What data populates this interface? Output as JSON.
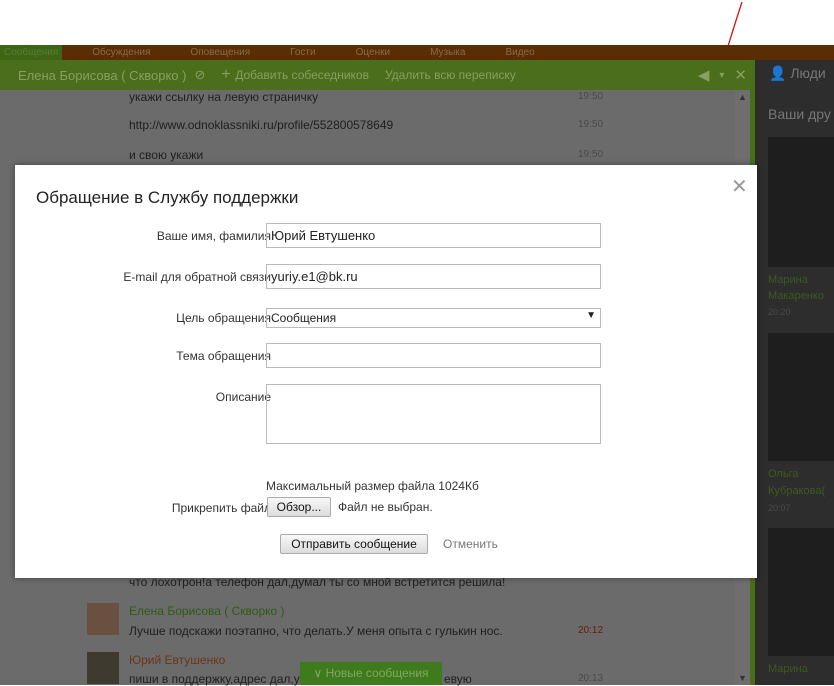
{
  "nav": {
    "items": [
      "Сообщения",
      "Обсуждения",
      "Оповещения",
      "Гости",
      "Оценки",
      "Музыка",
      "Видео"
    ]
  },
  "chat_header": {
    "name": "Елена Борисова ( Скворко )",
    "add": "Добавить собеседников",
    "delete": "Удалить всю переписку"
  },
  "messages": [
    {
      "text": "укажи ссылку на левую страничку",
      "time": "19:50"
    },
    {
      "text": "http://www.odnoklassniki.ru/profile/552800578649",
      "time": "19:50"
    },
    {
      "text": "и свою укажи",
      "time": "19:50"
    },
    {
      "text": "что лохотрон!а телефон дал,думал ты со мной встретится решила!"
    },
    {
      "author": "Елена Борисова ( Скворко )",
      "text": "Лучше подскажи поэтапно, что делать.У меня опыта с гулькин нос.",
      "time": "20:12"
    },
    {
      "author": "Юрий Евтушенко",
      "text": "пиши в поддержку,адрес дал,у",
      "text_end": "евую",
      "time": "20:13"
    }
  ],
  "new_messages": "Новые сообщения",
  "sidebar": {
    "people": "Люди",
    "friends": "Ваши дру",
    "friends_list": [
      {
        "name": "Марина",
        "name2": "Макаренко",
        "time": "20:20"
      },
      {
        "name": "Ольга",
        "name2": "Кубракова(",
        "time": "20:07"
      },
      {
        "name": "Марина"
      }
    ]
  },
  "modal": {
    "title": "Обращение в Службу поддержки",
    "name_label": "Ваше имя, фамилия",
    "name_value": "Юрий Евтушенко",
    "email_label": "E-mail для обратной связи",
    "email_value": "yuriy.e1@bk.ru",
    "purpose_label": "Цель обращения",
    "purpose_value": "Сообщения",
    "subject_label": "Тема обращения",
    "subject_value": "",
    "desc_label": "Описание",
    "desc_value": "",
    "max_size": "Максимальный размер файла 1024Кб",
    "attach_label": "Прикрепить файл",
    "browse": "Обзор...",
    "no_file": "Файл не выбран.",
    "submit": "Отправить сообщение",
    "cancel": "Отменить"
  }
}
